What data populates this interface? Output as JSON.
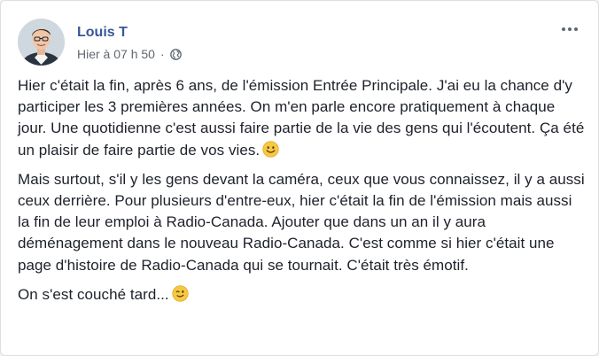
{
  "post": {
    "author": "Louis T",
    "timestamp": "Hier à 07 h 50",
    "separator": "·",
    "privacy_icon": "globe-icon",
    "more_icon": "more-options-icon",
    "paragraphs": [
      "Hier c'était la fin, après 6 ans, de l'émission Entrée Principale. J'ai eu la chance d'y participer les 3 premières années. On m'en parle encore pratiquement à chaque jour. Une quotidienne c'est aussi faire partie de la vie des gens qui l'écoutent. Ça été un plaisir de faire partie de vos vies.",
      "Mais surtout, s'il y les gens devant la caméra, ceux que vous connaissez, il y a aussi ceux derrière. Pour plusieurs d'entre-eux, hier c'était la fin de l'émission mais aussi la fin de leur emploi à Radio-Canada. Ajouter que dans un an il y aura déménagement dans le nouveau Radio-Canada. C'est comme si hier c'était une page d'histoire de Radio-Canada qui se tournait. C'était très émotif.",
      "On s'est couché tard..."
    ],
    "emojis": [
      "smile-emoji",
      "wink-emoji"
    ]
  },
  "colors": {
    "author": "#385898",
    "meta": "#606770",
    "text": "#1d2129",
    "emoji": "#f7c940"
  }
}
